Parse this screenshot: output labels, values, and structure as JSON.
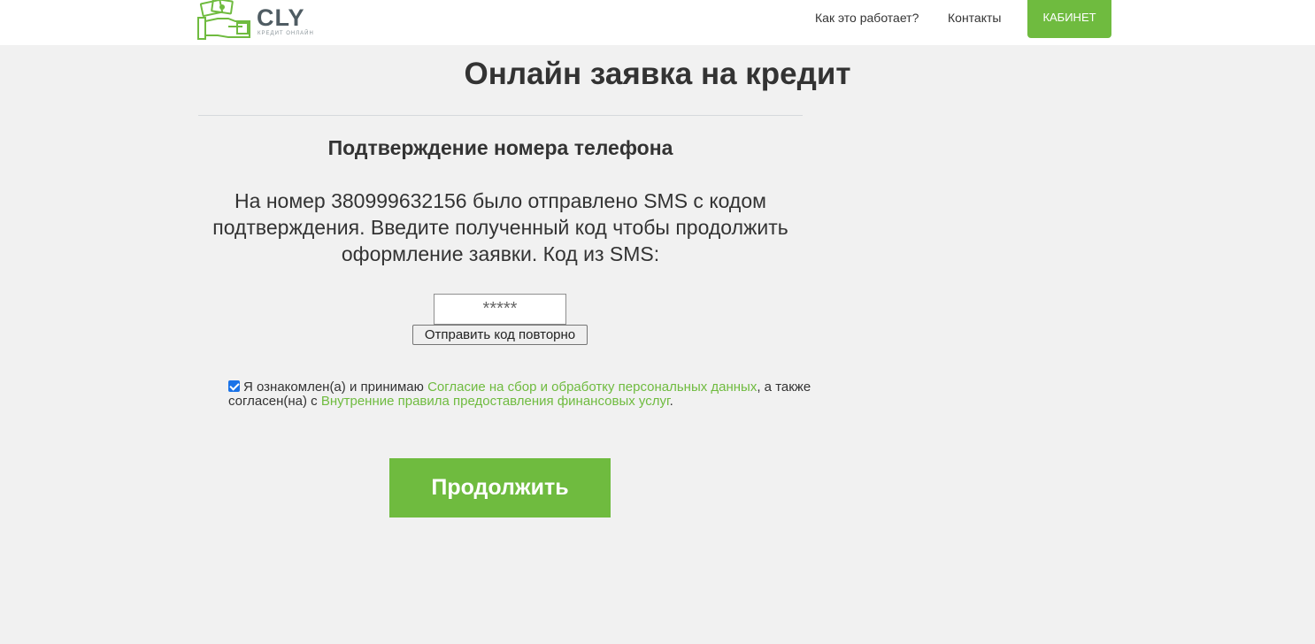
{
  "header": {
    "logo": {
      "name": "CLY",
      "tagline": "КРЕДИТ ОНЛАЙН",
      "icon": "money-hand-icon"
    },
    "nav": [
      {
        "label": "Как это работает?"
      },
      {
        "label": "Контакты"
      }
    ],
    "cabinet_label": "КАБИНЕТ"
  },
  "main": {
    "title": "Онлайн заявка на кредит",
    "section_title": "Подтверждение номера телефона",
    "sms_text": "На номер 380999632156 было отправлено SMS с кодом подтверждения. Введите полученный код чтобы продолжить оформление заявки. Код из SMS:",
    "code_input": {
      "value": "",
      "placeholder": "*****"
    },
    "resend_label": "Отправить код повторно",
    "consent": {
      "checked": true,
      "text_1": "Я ознакомлен(а) и принимаю ",
      "link_1": "Согласие на сбор и обработку персональных данных",
      "text_2": ", а также согласен(на) с ",
      "link_2": "Внутренние правила предоставления финансовых услуг",
      "text_3": "."
    },
    "continue_label": "Продолжить"
  },
  "colors": {
    "accent": "#6fbb3f",
    "background": "#f1f1f1",
    "text": "#333333"
  }
}
